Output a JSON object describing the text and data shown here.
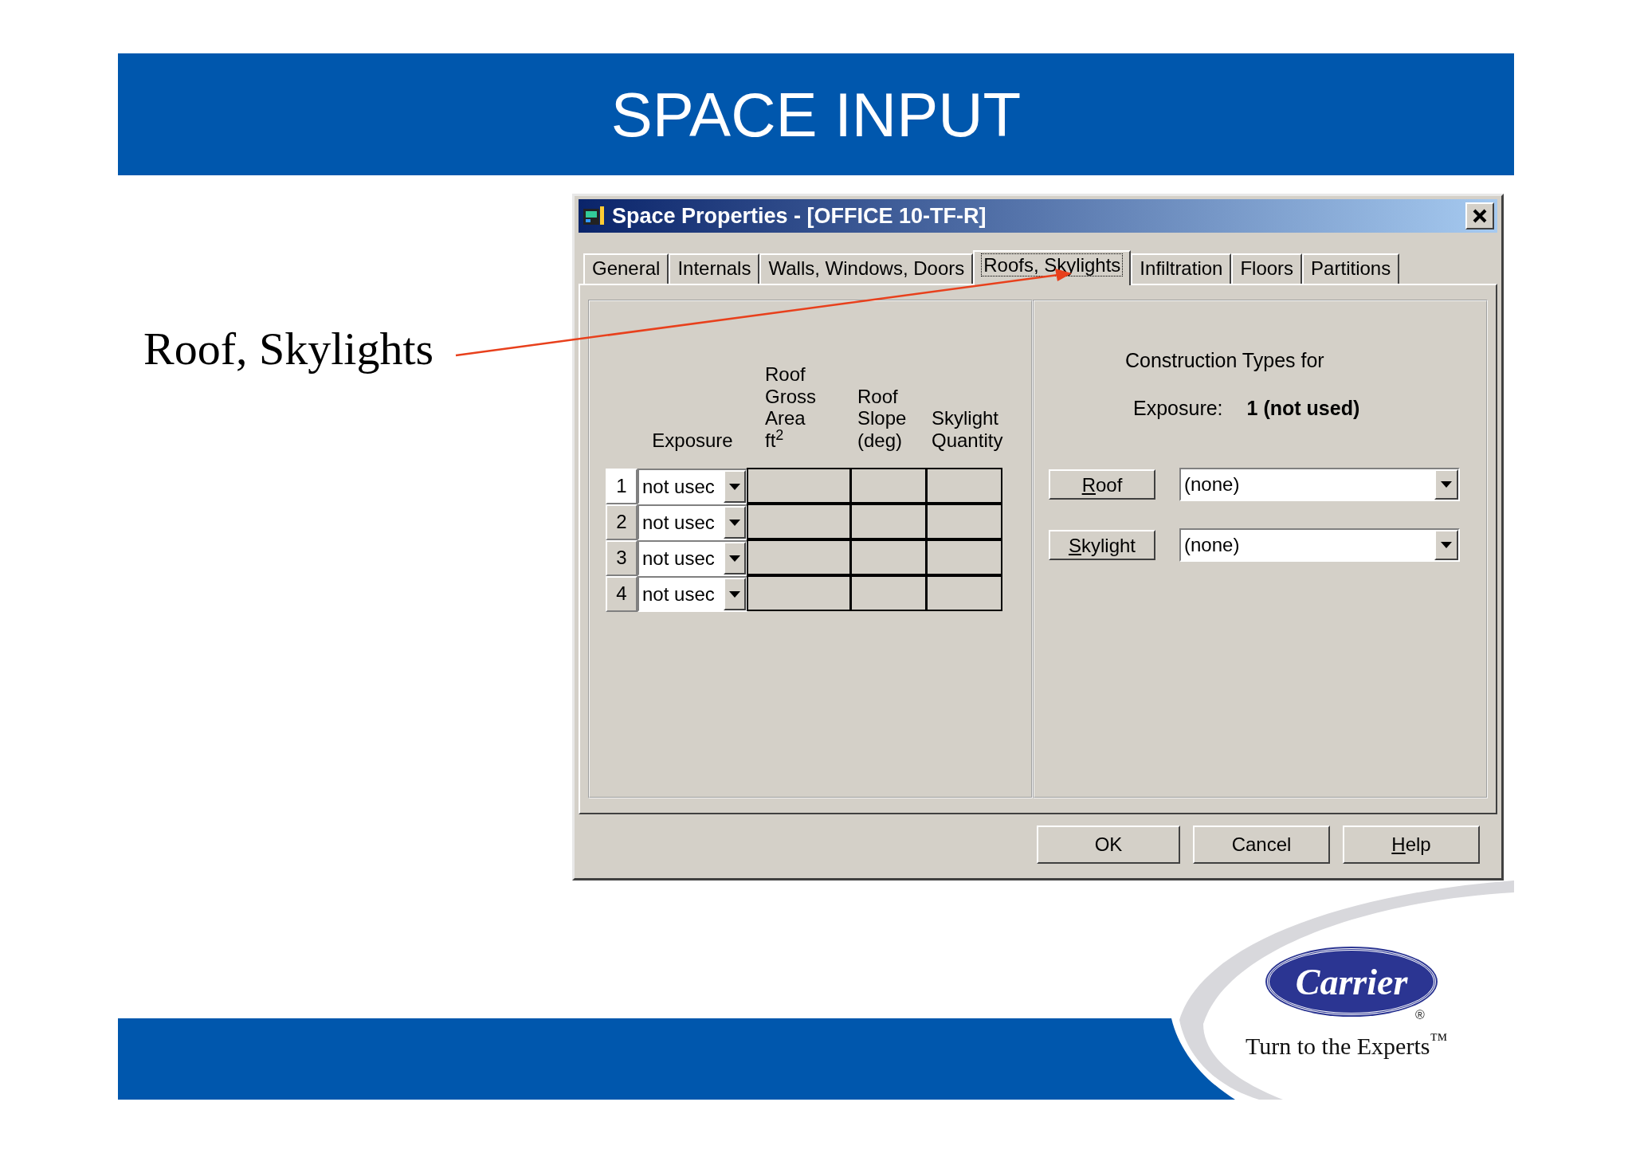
{
  "slide": {
    "title": "SPACE INPUT",
    "callout": "Roof, Skylights"
  },
  "dialog": {
    "title": "Space Properties - [OFFICE 10-TF-R]",
    "tabs": [
      {
        "label": "General",
        "selected": false
      },
      {
        "label": "Internals",
        "selected": false
      },
      {
        "label": "Walls, Windows, Doors",
        "selected": false
      },
      {
        "label": "Roofs, Skylights",
        "selected": true
      },
      {
        "label": "Infiltration",
        "selected": false
      },
      {
        "label": "Floors",
        "selected": false
      },
      {
        "label": "Partitions",
        "selected": false
      }
    ],
    "exposure_table": {
      "columns": [
        {
          "lines": [
            "Exposure"
          ]
        },
        {
          "lines": [
            "Roof",
            "Gross",
            "Area",
            "ft$^{2}$"
          ]
        },
        {
          "lines": [
            "Roof",
            "Slope",
            "(deg)"
          ]
        },
        {
          "lines": [
            "Skylight",
            "Quantity"
          ]
        }
      ],
      "rows": [
        {
          "number": "1",
          "exposure": "not usec",
          "selected": true
        },
        {
          "number": "2",
          "exposure": "not usec",
          "selected": false
        },
        {
          "number": "3",
          "exposure": "not usec",
          "selected": false
        },
        {
          "number": "4",
          "exposure": "not usec",
          "selected": false
        }
      ]
    },
    "construction": {
      "heading": "Construction Types for",
      "exposure_label": "Exposure:",
      "exposure_value": "1 (not used)",
      "items": [
        {
          "button": "Roof",
          "underlined_first_letter": true,
          "value": "(none)"
        },
        {
          "button": "Skylight",
          "underlined_first_letter": true,
          "value": "(none)"
        }
      ]
    },
    "buttons": [
      {
        "label": "OK",
        "underlined_first_letter": false
      },
      {
        "label": "Cancel",
        "underlined_first_letter": false
      },
      {
        "label": "Help",
        "underlined_first_letter": true
      }
    ]
  },
  "logo": {
    "brand": "Carrier",
    "registered": "®",
    "tagline": "Turn to the Experts$^{™}$"
  }
}
